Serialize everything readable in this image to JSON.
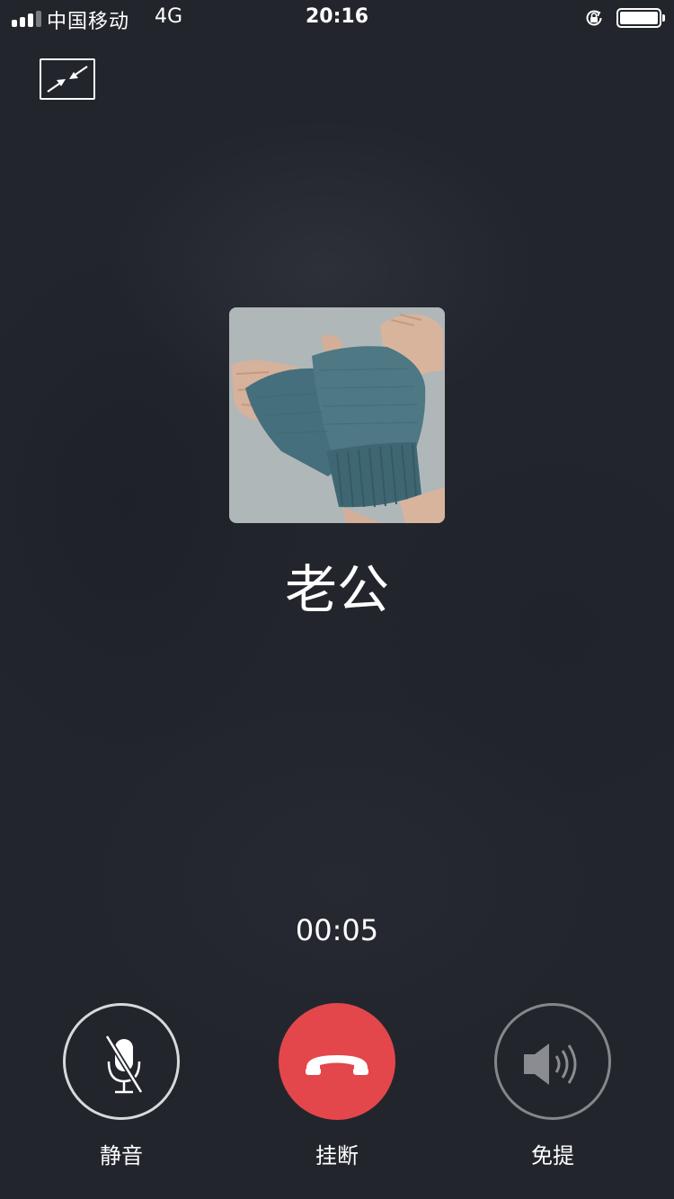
{
  "status_bar": {
    "carrier": "中国移动",
    "network": "4G",
    "time": "20:16",
    "signal_bars": 4,
    "signal_bars_active": 3,
    "battery_level": 1.0
  },
  "header": {
    "minimize_icon": "minimize-arrows-icon"
  },
  "contact": {
    "name": "老公",
    "avatar_description_icon": "knitted-gloves-avatar"
  },
  "call": {
    "timer": "00:05"
  },
  "controls": {
    "mute": {
      "label": "静音",
      "icon": "mic-off-icon"
    },
    "hangup": {
      "label": "挂断",
      "icon": "phone-hangup-icon"
    },
    "speaker": {
      "label": "免提",
      "icon": "speaker-icon"
    }
  },
  "colors": {
    "background": "#23252d",
    "hangup": "#e3474b",
    "text": "#ffffff",
    "inactive_ring": "#85878c"
  }
}
